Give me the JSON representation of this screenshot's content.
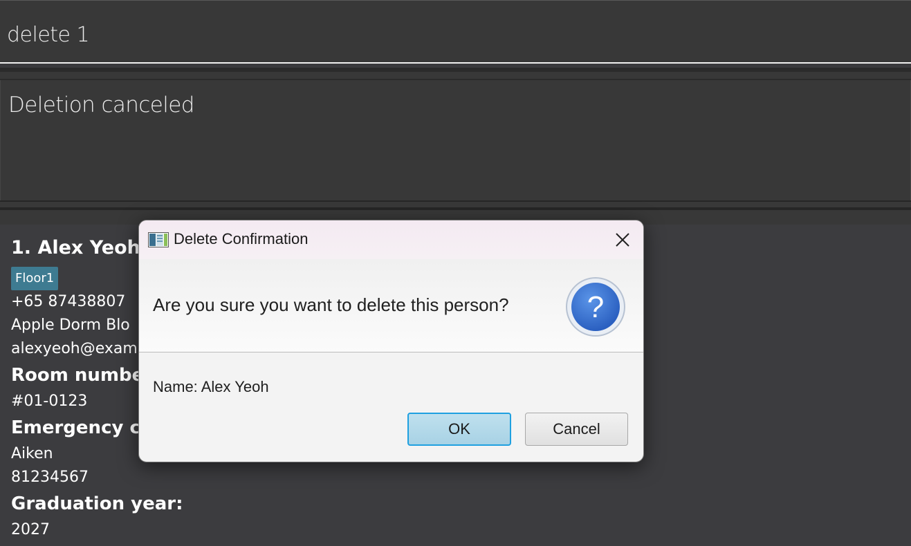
{
  "command": {
    "input_value": "delete 1"
  },
  "result": {
    "text": "Deletion canceled"
  },
  "person": {
    "title": "1. Alex Yeoh",
    "tag": "Floor1",
    "phone": "+65 87438807",
    "address": "Apple Dorm Blo",
    "email": "alexyeoh@exam",
    "room_heading": "Room numbe",
    "room_value": "#01-0123",
    "emergency_heading": "Emergency co",
    "emergency_name": "Aiken",
    "emergency_phone": "81234567",
    "graduation_heading": "Graduation year:",
    "graduation_value": "2027"
  },
  "dialog": {
    "title": "Delete Confirmation",
    "header": "Are you sure you want to delete this person?",
    "content": "Name: Alex Yeoh",
    "ok_label": "OK",
    "cancel_label": "Cancel",
    "icon": "question-icon",
    "close_icon": "close-icon",
    "app_icon": "app-icon"
  },
  "colors": {
    "background": "#3a3a3d",
    "tag_bg": "#3e7b91",
    "ok_border": "#1fa0e0",
    "question_blue": "#2f6fd0"
  }
}
